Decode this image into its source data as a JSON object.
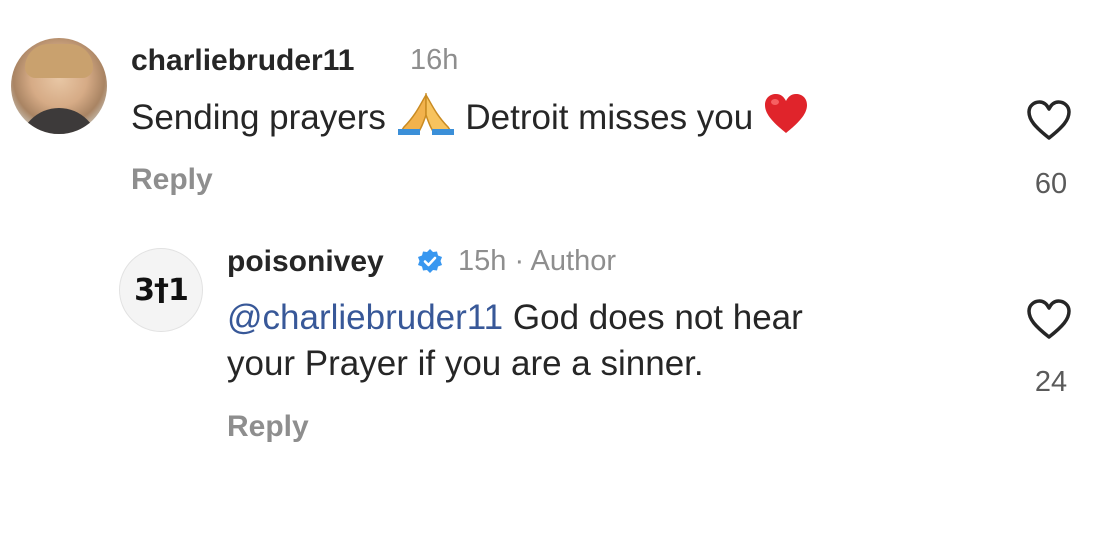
{
  "comments": [
    {
      "username": "charliebruder11",
      "time": "16h",
      "text_before": "Sending prayers",
      "text_after": "Detroit misses you",
      "emojis": [
        "folded-hands-emoji",
        "red-heart-emoji"
      ],
      "reply_label": "Reply",
      "likes": "60"
    }
  ],
  "reply": {
    "avatar_text": "3†1",
    "username": "poisonivey",
    "verified": true,
    "meta": "15h · Author",
    "mention": "@charliebruder11",
    "text_line1": "God does not hear",
    "text_line2": "your Prayer if you are a sinner.",
    "reply_label": "Reply",
    "likes": "24"
  },
  "colors": {
    "text": "#262626",
    "secondary": "#8e8e8e",
    "mention": "#385898",
    "verified": "#3897f0"
  }
}
